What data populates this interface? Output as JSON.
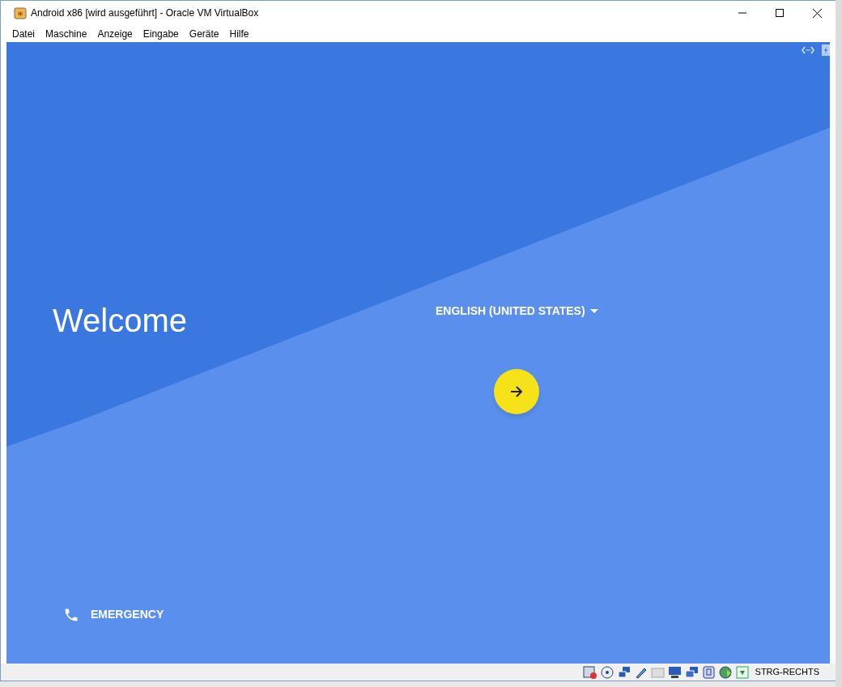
{
  "window": {
    "title": "Android x86 [wird ausgeführt] - Oracle VM VirtualBox"
  },
  "menu": [
    "Datei",
    "Maschine",
    "Anzeige",
    "Eingabe",
    "Geräte",
    "Hilfe"
  ],
  "screen": {
    "welcome": "Welcome",
    "language": "ENGLISH (UNITED STATES)",
    "emergency": "EMERGENCY"
  },
  "status_bar": {
    "host_key": "STRG-RECHTS"
  }
}
